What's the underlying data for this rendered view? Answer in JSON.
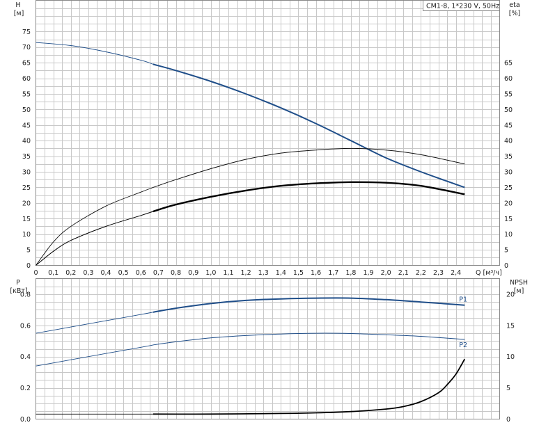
{
  "chart_data": [
    {
      "type": "line",
      "title": "CM1-8, 1*230 V, 50Hz",
      "xlabel": "Q [м³/ч]",
      "ylabel_left": "H",
      "ylabel_left_unit": "[м]",
      "ylabel_right": "eta",
      "ylabel_right_unit": "[%]",
      "xlim": [
        0,
        2.65
      ],
      "ylim": [
        0,
        85
      ],
      "grid": true,
      "x_ticks": [
        "0",
        "0,1",
        "0,2",
        "0,3",
        "0,4",
        "0,5",
        "0,6",
        "0,7",
        "0,8",
        "0,9",
        "1,0",
        "1,1",
        "1,2",
        "1,3",
        "1,4",
        "1,5",
        "1,6",
        "1,7",
        "1,8",
        "1,9",
        "2,0",
        "2,1",
        "2,2",
        "2,3",
        "2,4"
      ],
      "x_tick_values": [
        0,
        0.1,
        0.2,
        0.3,
        0.4,
        0.5,
        0.6,
        0.7,
        0.8,
        0.9,
        1.0,
        1.1,
        1.2,
        1.3,
        1.4,
        1.5,
        1.6,
        1.7,
        1.8,
        1.9,
        2.0,
        2.1,
        2.2,
        2.3,
        2.4
      ],
      "y_ticks_left": [
        "0",
        "5",
        "10",
        "15",
        "20",
        "25",
        "30",
        "35",
        "40",
        "45",
        "50",
        "55",
        "60",
        "65",
        "70",
        "75"
      ],
      "y_tick_values_left": [
        0,
        5,
        10,
        15,
        20,
        25,
        30,
        35,
        40,
        45,
        50,
        55,
        60,
        65,
        70,
        75
      ],
      "y_ticks_right": [
        "0",
        "5",
        "10",
        "15",
        "20",
        "25",
        "30",
        "35",
        "40",
        "45",
        "50",
        "55",
        "60",
        "65"
      ],
      "y_tick_values_right": [
        0,
        5,
        10,
        15,
        20,
        25,
        30,
        35,
        40,
        45,
        50,
        55,
        60,
        65
      ],
      "series": [
        {
          "color": "#1f4e89",
          "x": [
            0,
            0.2,
            0.4,
            0.6,
            0.67,
            0.8,
            1.0,
            1.2,
            1.4,
            1.6,
            1.8,
            2.0,
            2.2,
            2.45
          ],
          "y": [
            71.5,
            70.5,
            68.5,
            65.8,
            64.5,
            62.5,
            59.0,
            55.0,
            50.5,
            45.5,
            40.0,
            34.5,
            30.0,
            25.0
          ]
        },
        {
          "color": "#111111",
          "x": [
            0,
            0.1,
            0.2,
            0.4,
            0.6,
            0.67,
            0.8,
            1.0,
            1.2,
            1.4,
            1.6,
            1.8,
            2.0,
            2.2,
            2.45
          ],
          "y": [
            0,
            7.5,
            12.5,
            19.0,
            23.5,
            25.0,
            27.5,
            31.0,
            34.0,
            36.0,
            37.0,
            37.5,
            37.0,
            35.5,
            32.5
          ]
        },
        {
          "color": "#000000",
          "x": [
            0,
            0.1,
            0.2,
            0.4,
            0.6,
            0.67,
            0.8,
            1.0,
            1.2,
            1.4,
            1.6,
            1.8,
            2.0,
            2.2,
            2.45
          ],
          "y": [
            0,
            4.5,
            8.0,
            12.5,
            16.0,
            17.3,
            19.5,
            22.0,
            24.0,
            25.5,
            26.3,
            26.7,
            26.5,
            25.5,
            22.8
          ]
        }
      ]
    },
    {
      "type": "line",
      "xlabel": "",
      "ylabel_left": "P",
      "ylabel_left_unit": "[кВт]",
      "ylabel_right": "NPSH",
      "ylabel_right_unit": "[м]",
      "xlim": [
        0,
        2.65
      ],
      "ylim": [
        0,
        0.9
      ],
      "ylim_right": [
        0,
        22.5
      ],
      "grid": true,
      "y_ticks_left": [
        "0.0",
        "0.2",
        "0.4",
        "0.6",
        "0.8"
      ],
      "y_tick_values_left": [
        0,
        0.2,
        0.4,
        0.6,
        0.8
      ],
      "y_ticks_right": [
        "0",
        "5",
        "10",
        "15",
        "20"
      ],
      "y_tick_values_right": [
        0,
        5,
        10,
        15,
        20
      ],
      "series": [
        {
          "name": "P1",
          "color": "#1f4e89",
          "x": [
            0,
            0.2,
            0.4,
            0.6,
            0.67,
            0.8,
            1.0,
            1.2,
            1.4,
            1.6,
            1.8,
            2.0,
            2.2,
            2.45
          ],
          "y": [
            0.55,
            0.59,
            0.63,
            0.67,
            0.685,
            0.71,
            0.74,
            0.76,
            0.77,
            0.775,
            0.775,
            0.765,
            0.75,
            0.73
          ]
        },
        {
          "name": "P2",
          "color": "#1f4e89",
          "x": [
            0,
            0.2,
            0.4,
            0.6,
            0.67,
            0.8,
            1.0,
            1.2,
            1.4,
            1.6,
            1.8,
            2.0,
            2.2,
            2.45
          ],
          "y": [
            0.34,
            0.38,
            0.42,
            0.46,
            0.475,
            0.495,
            0.52,
            0.535,
            0.545,
            0.55,
            0.548,
            0.54,
            0.53,
            0.51
          ]
        },
        {
          "axis": "right",
          "color": "#000000",
          "x": [
            0,
            0.67,
            1.0,
            1.4,
            1.6,
            1.8,
            2.0,
            2.1,
            2.2,
            2.3,
            2.35,
            2.4,
            2.45
          ],
          "y": [
            0.8,
            0.8,
            0.8,
            0.9,
            1.0,
            1.2,
            1.6,
            2.0,
            2.8,
            4.2,
            5.5,
            7.2,
            9.6
          ]
        }
      ]
    }
  ]
}
